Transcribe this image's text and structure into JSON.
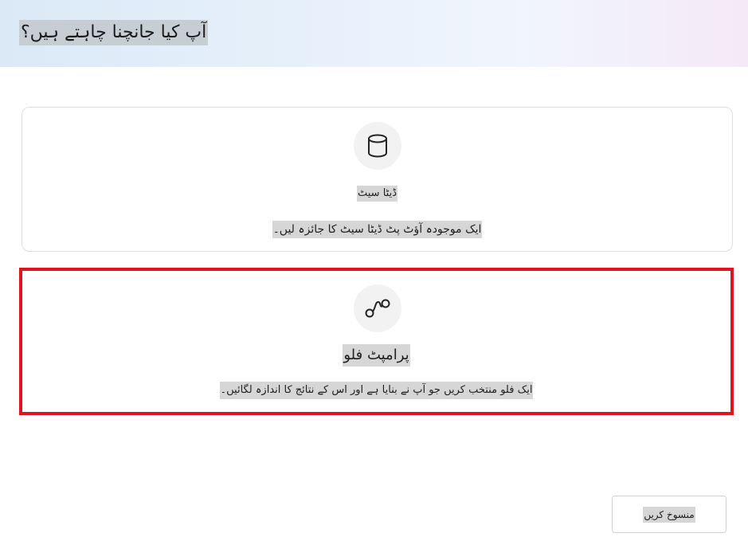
{
  "header": {
    "title": "آپ کیا جانچنا چاہتے ہیں؟"
  },
  "options": [
    {
      "icon": "database-icon",
      "title": "ڈیٹا سیٹ",
      "description": "ایک موجودہ آؤٹ پٹ ڈیٹا سیٹ کا جائزہ لیں۔"
    },
    {
      "icon": "flow-icon",
      "title": "پرامپٹ فلو",
      "description": "ایک فلو منتخب کریں جو آپ نے بنایا ہے اور اس کے نتائج کا اندازہ لگائیں۔",
      "selected": true
    }
  ],
  "footer": {
    "cancel_label": "منسوخ کریں"
  },
  "colors": {
    "selection_border": "#e0141e",
    "icon_background": "#f2f2f2"
  }
}
